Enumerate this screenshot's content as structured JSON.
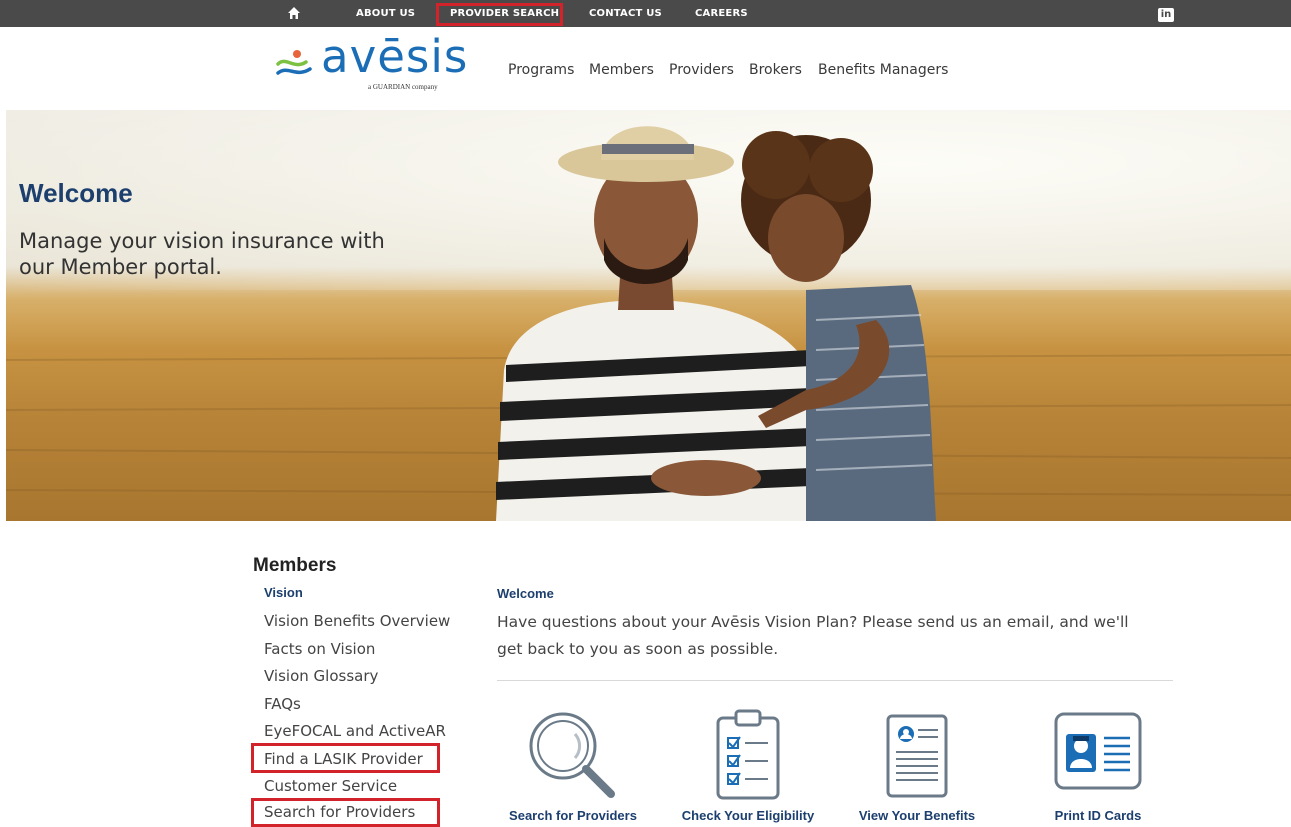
{
  "topbar": {
    "links": [
      "ABOUT US",
      "PROVIDER SEARCH",
      "CONTACT US",
      "CAREERS"
    ],
    "social": "in"
  },
  "logo": {
    "word": "avēsis",
    "sub": "a GUARDIAN company"
  },
  "nav": [
    "Programs",
    "Members",
    "Providers",
    "Brokers",
    "Benefits Managers"
  ],
  "hero": {
    "title": "Welcome",
    "text": "Manage your vision insurance with our Member portal."
  },
  "sidebar": {
    "title": "Members",
    "subtitle": "Vision",
    "items": [
      "Vision Benefits Overview",
      "Facts on Vision",
      "Vision Glossary",
      "FAQs",
      "EyeFOCAL and ActiveAR",
      "Find a LASIK Provider",
      "Customer Service",
      "Search for Providers"
    ]
  },
  "main": {
    "heading": "Welcome",
    "paragraph": "Have questions about your Avēsis Vision Plan? Please send us an email, and we'll get back to you as soon as possible.",
    "tiles": [
      {
        "label": "Search for Providers",
        "icon": "magnifier-icon"
      },
      {
        "label": "Check Your Eligibility",
        "icon": "clipboard-checklist-icon"
      },
      {
        "label": "View Your Benefits",
        "icon": "document-profile-icon"
      },
      {
        "label": "Print ID Cards",
        "icon": "id-card-icon"
      }
    ]
  },
  "colors": {
    "brand_blue": "#1b6eb6",
    "navy": "#1c3f6e",
    "highlight_red": "#d2232a",
    "topbar": "#4a4a4a"
  }
}
